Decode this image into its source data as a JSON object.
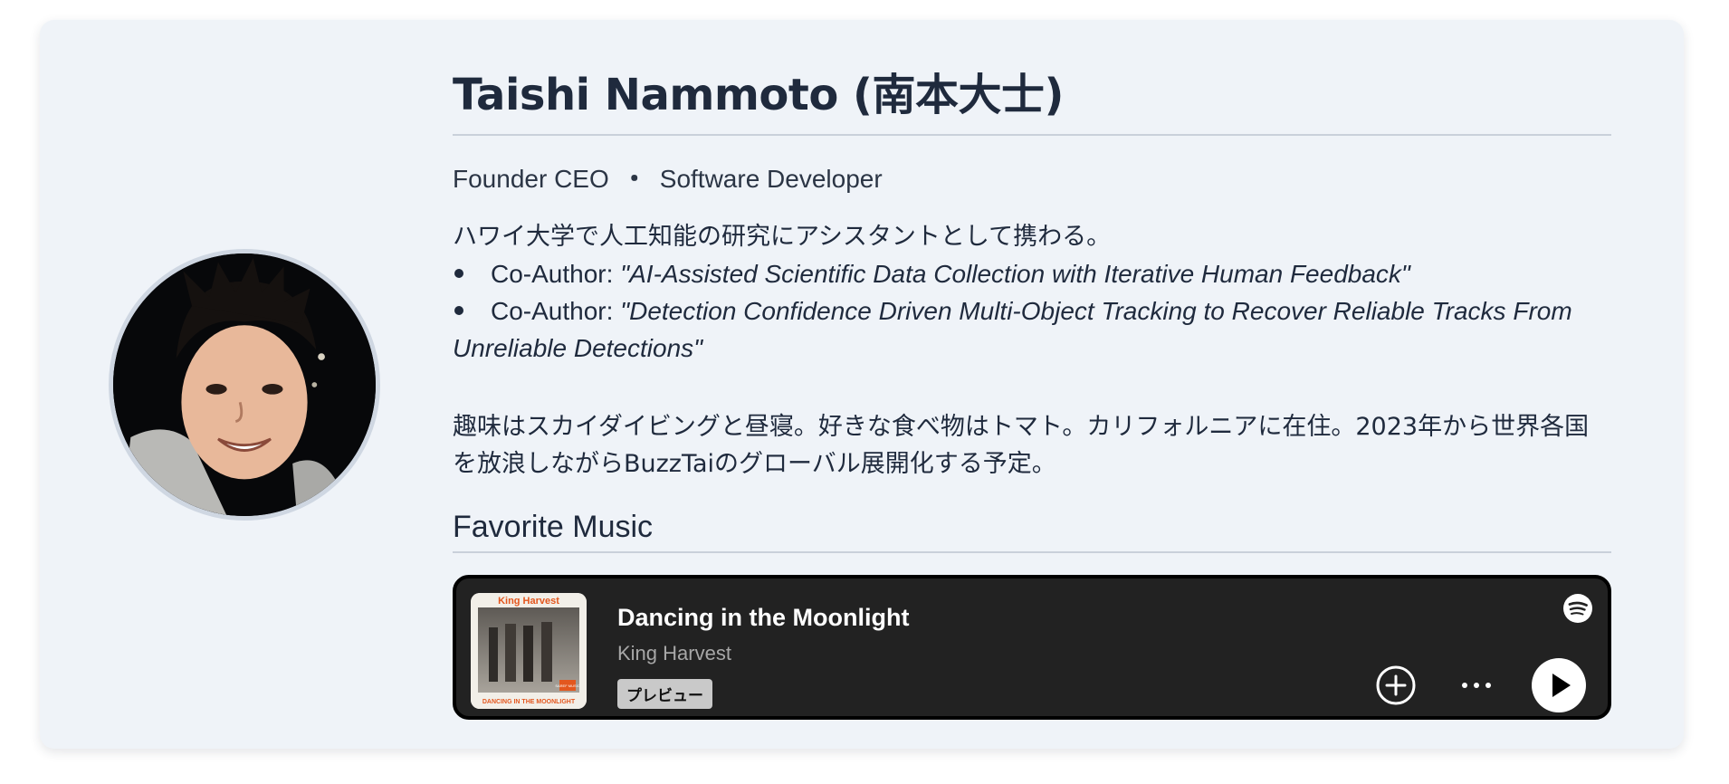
{
  "profile": {
    "name": "Taishi Nammoto (南本大士)",
    "roles": [
      "Founder CEO",
      "Software Developer"
    ],
    "role_separator": "・",
    "bio_intro": "ハワイ大学で人工知能の研究にアシスタントとして携わる。",
    "publications": [
      {
        "prefix": "Co-Author: ",
        "title": "\"AI-Assisted Scientific Data Collection with Iterative Human Feedback\""
      },
      {
        "prefix": "Co-Author: ",
        "title": "\"Detection Confidence Driven Multi-Object Tracking to Recover Reliable Tracks From Unreliable Detections\""
      }
    ],
    "hobbies": "趣味はスカイダイビングと昼寝。好きな食べ物はトマト。カリフォルニアに在住。2023年から世界各国を放浪しながらBuzzTaiのグローバル展開化する予定。"
  },
  "music": {
    "section_title": "Favorite Music",
    "track": "Dancing in the Moonlight",
    "artist": "King Harvest",
    "preview_label": "プレビュー",
    "cover_top_text": "King Harvest",
    "cover_bottom_text": "DANCING IN THE MOONLIGHT",
    "cover_badge_text": "SAREF MUSIC"
  },
  "icons": {
    "spotify": "spotify-icon",
    "add": "plus-circle-icon",
    "more": "more-horizontal-icon",
    "play": "play-icon"
  },
  "colors": {
    "card_background": "#eff3f8",
    "text": "#1f2a3d",
    "player_background": "#222222",
    "cover_accent": "#e3571e"
  }
}
